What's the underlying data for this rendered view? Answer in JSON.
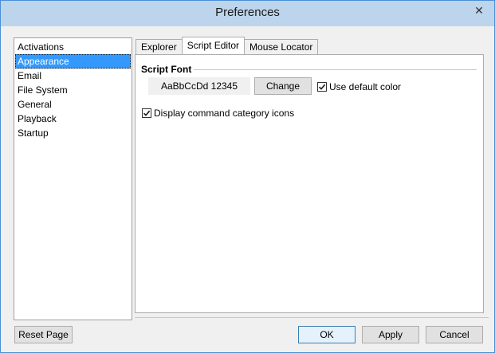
{
  "window": {
    "title": "Preferences",
    "close_glyph": "✕"
  },
  "sidebar": {
    "items": [
      {
        "label": "Activations"
      },
      {
        "label": "Appearance",
        "selected": true
      },
      {
        "label": "Email"
      },
      {
        "label": "File System"
      },
      {
        "label": "General"
      },
      {
        "label": "Playback"
      },
      {
        "label": "Startup"
      }
    ]
  },
  "tabs": [
    {
      "label": "Explorer"
    },
    {
      "label": "Script Editor",
      "active": true
    },
    {
      "label": "Mouse Locator"
    }
  ],
  "script_font": {
    "group_label": "Script Font",
    "sample_text": "AaBbCcDd 12345",
    "change_label": "Change",
    "use_default_color_label": "Use default color",
    "use_default_color_checked": true
  },
  "display_icons": {
    "label": "Display command category icons",
    "checked": true
  },
  "footer": {
    "reset_label": "Reset Page",
    "ok_label": "OK",
    "apply_label": "Apply",
    "cancel_label": "Cancel"
  },
  "colors": {
    "selection": "#3399ff",
    "titlebar": "#bcd5ec",
    "default_button_border": "#3c7fb1"
  }
}
